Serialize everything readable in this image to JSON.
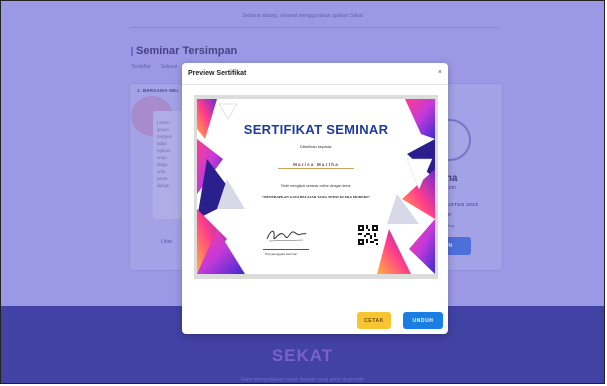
{
  "background_page": {
    "welcome_text": "Selamat datang, selamat menggunakan aplikasi Sekat",
    "section_title": "Seminar Tersimpan",
    "tabs": [
      "Terdaftar",
      "Selesai"
    ],
    "card_label": "1. BERSAMA MEL",
    "left_text_lines": [
      "Lorem",
      "ipsum",
      "tempus",
      "adipi",
      "ngkum",
      "sequ",
      "ditipu",
      "sele",
      "perte",
      "dpngn"
    ],
    "view_link": "Lihat",
    "participant_name": "artha",
    "participant_email": "gmail.com",
    "date_text": "AGUSTUS 2023",
    "code_text": "00087",
    "status_text": "Ongoing",
    "action_button": "UN"
  },
  "footer": {
    "brand": "SEKAT",
    "tagline": "Kami menyediakan masih banyak yang perlu di periode"
  },
  "modal": {
    "title": "Preview Sertifikat",
    "close_label": "×",
    "certificate": {
      "title": "SERTIFIKAT SEMINAR",
      "given_to": "Diberikan kepada:",
      "recipient": "Marisa Martha",
      "attended_text": "Telah mengikuti seminar online dengan tema:",
      "topic": "\"MENERAPKAN GAYA BELAJAR YANG TEPAT DI ERA MODERN\"",
      "signer_label": "Penyelenggara Seminar"
    },
    "buttons": {
      "print": "CETAK",
      "download": "UNDUH"
    }
  },
  "colors": {
    "page_bg": "#a9a6ff",
    "footer_bg": "#2e2fa6",
    "print_button": "#f7c531",
    "download_button": "#1a7ee3",
    "certificate_title": "#1d3c9b"
  }
}
